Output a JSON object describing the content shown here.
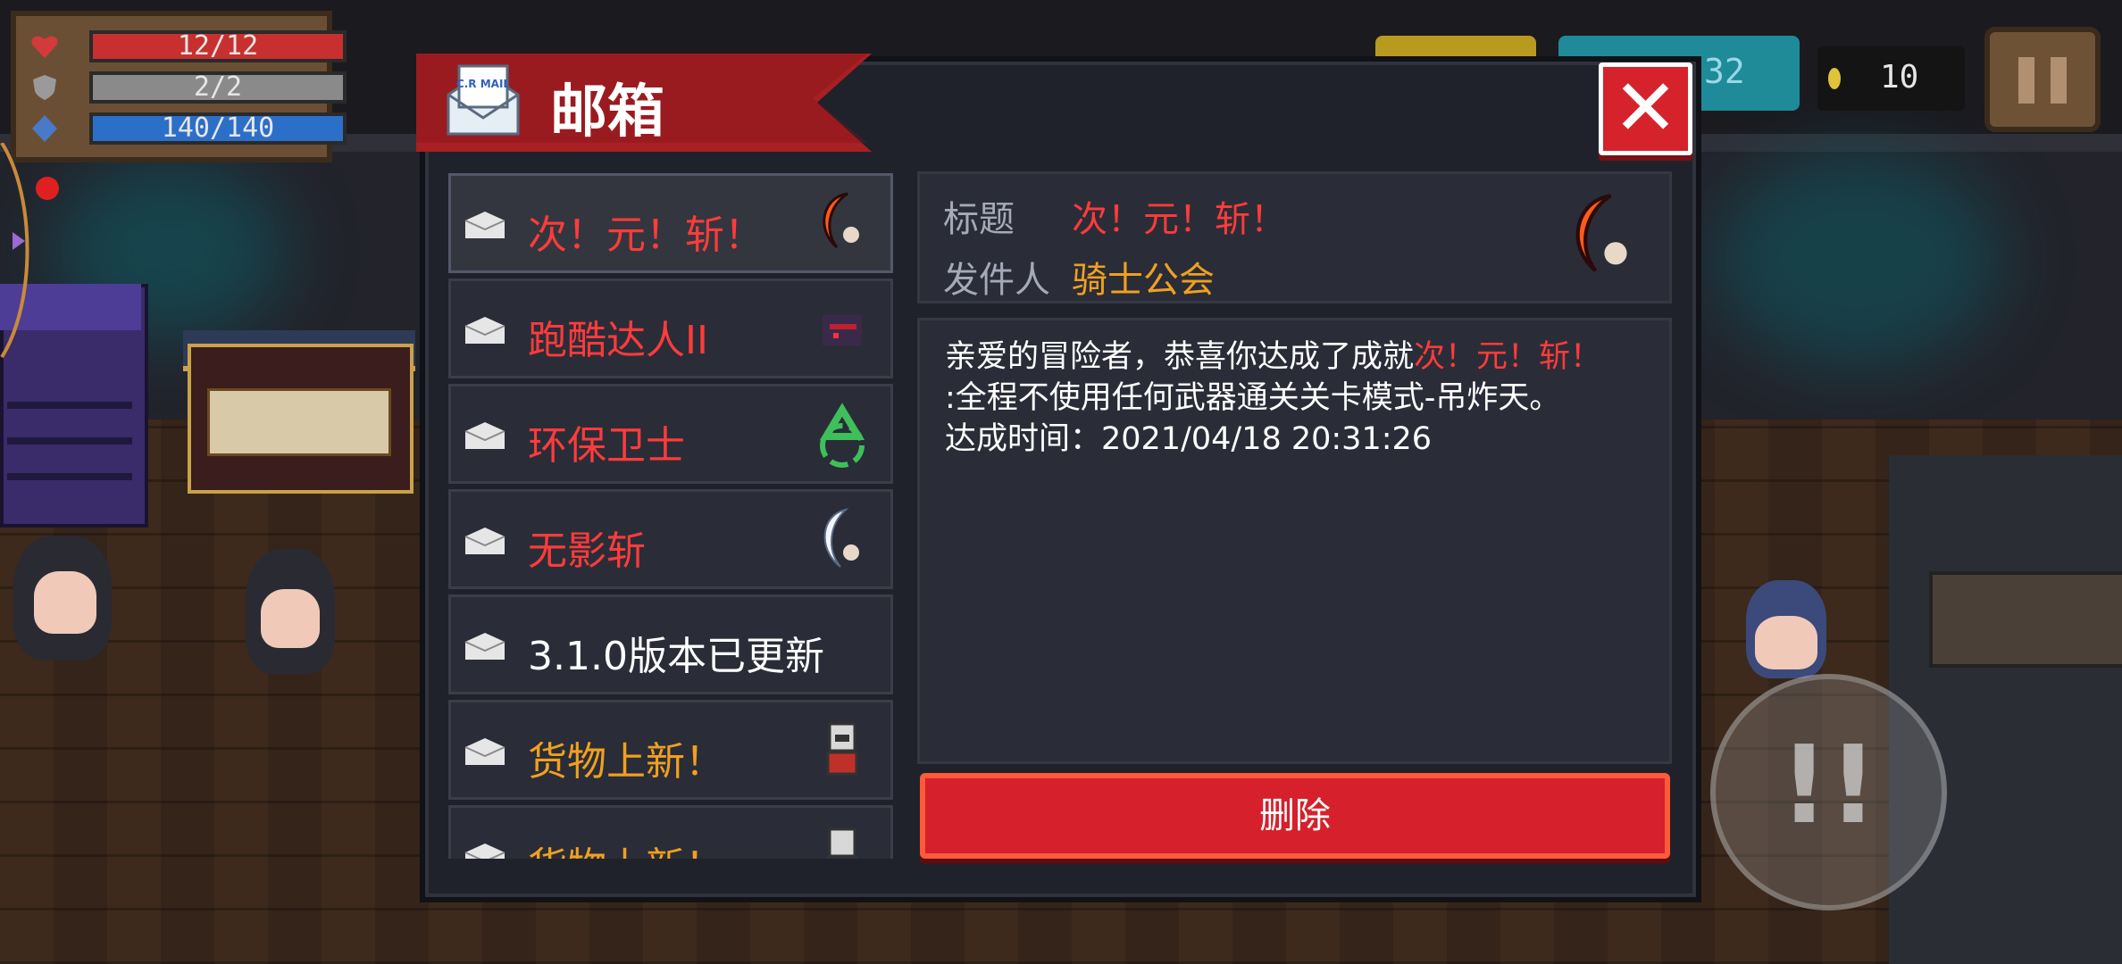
{
  "hud": {
    "health": "12/12",
    "armor": "2/2",
    "energy": "140/140",
    "gems": "32",
    "coins": "10"
  },
  "mailbox": {
    "title": "邮箱",
    "mail_icon_text": "C.R MAIL",
    "items": [
      {
        "label": "次！元！斩！",
        "color": "#ff3b3b",
        "icon": "crescent-blade-icon",
        "selected": true
      },
      {
        "label": "跑酷达人II",
        "color": "#ff3b3b",
        "icon": "ninja-icon"
      },
      {
        "label": "环保卫士",
        "color": "#ff3b3b",
        "icon": "recycle-icon"
      },
      {
        "label": "无影斩",
        "color": "#ff3b3b",
        "icon": "white-crescent-icon"
      },
      {
        "label": "3.1.0版本已更新",
        "color": "#ffffff",
        "icon": ""
      },
      {
        "label": "货物上新！",
        "color": "#f0a020",
        "icon": "merchant-icon"
      },
      {
        "label": "货物上新！",
        "color": "#f0a020",
        "icon": "merchant-icon"
      }
    ],
    "detail": {
      "title_label": "标题",
      "title_value": "次！元！斩！",
      "sender_label": "发件人",
      "sender_value": "骑士公会",
      "body_prefix": "亲爱的冒险者，恭喜你达成了成就",
      "body_highlight": "次！元！斩！",
      "body_line2": ":全程不使用任何武器通关关卡模式-吊炸天。",
      "body_line3": "达成时间：2021/04/18 20:31:26"
    },
    "delete_label": "删除"
  },
  "colors": {
    "accent_red": "#d6202b",
    "highlight_red": "#ff3b3b",
    "sender_gold": "#f0a020",
    "panel_bg": "#1f222b"
  }
}
